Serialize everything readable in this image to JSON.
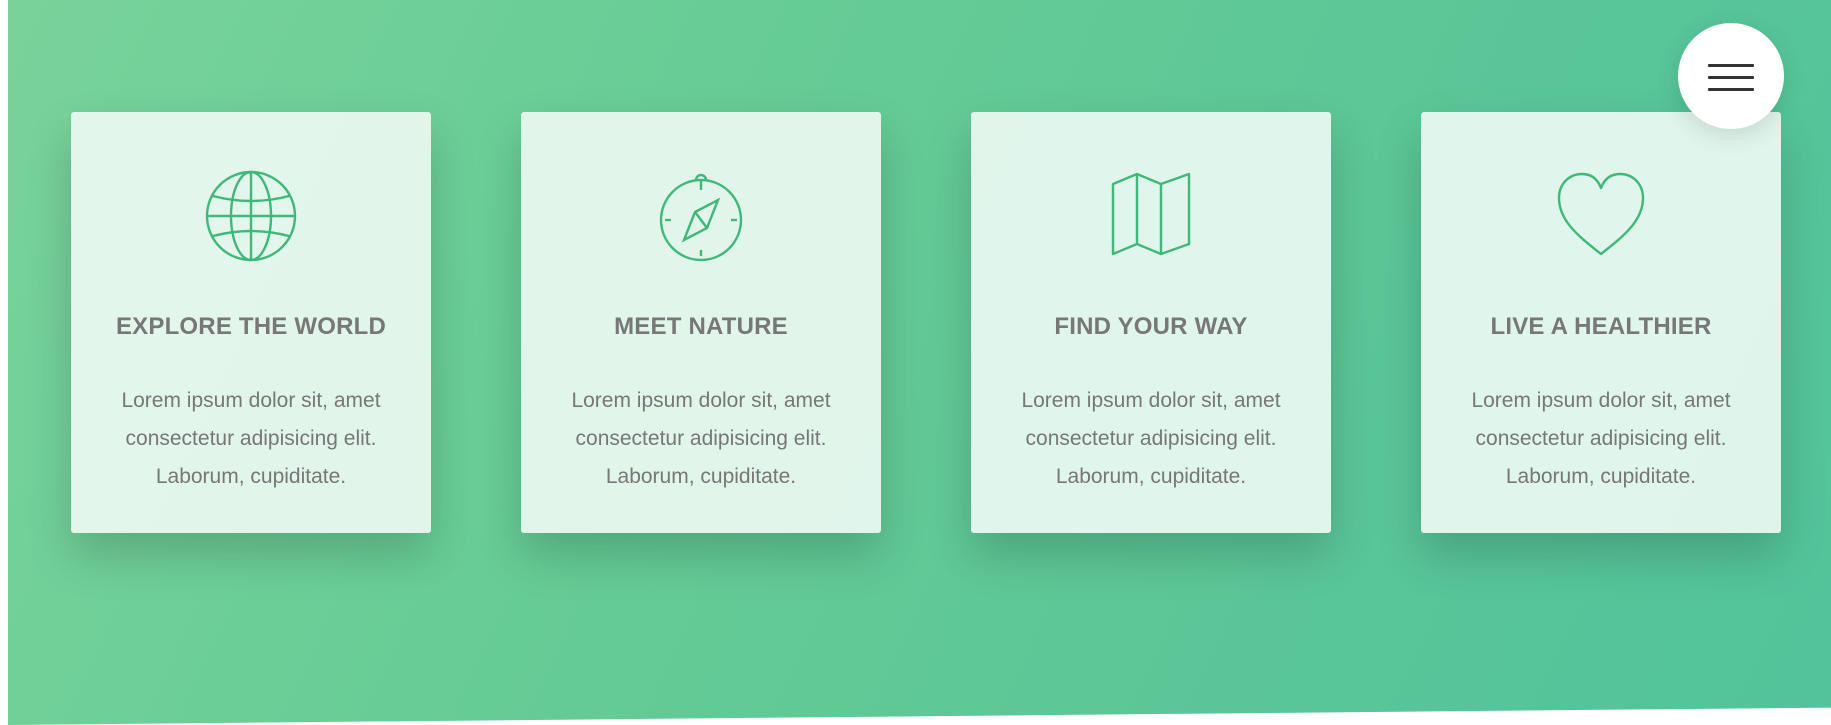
{
  "menu": {
    "icon": "hamburger-menu-icon"
  },
  "colors": {
    "accent": "#55c57a",
    "gradient_start": "#7ed56f",
    "gradient_end": "#28b485",
    "card_background": "#e6f7ee",
    "text": "#777777"
  },
  "features": [
    {
      "icon": "globe-icon",
      "title": "EXPLORE THE WORLD",
      "text": "Lorem ipsum dolor sit, amet consectetur adipisicing elit. Laborum, cupiditate."
    },
    {
      "icon": "compass-icon",
      "title": "MEET NATURE",
      "text": "Lorem ipsum dolor sit, amet consectetur adipisicing elit. Laborum, cupiditate."
    },
    {
      "icon": "map-icon",
      "title": "FIND YOUR WAY",
      "text": "Lorem ipsum dolor sit, amet consectetur adipisicing elit. Laborum, cupiditate."
    },
    {
      "icon": "heart-icon",
      "title": "LIVE A HEALTHIER",
      "text": "Lorem ipsum dolor sit, amet consectetur adipisicing elit. Laborum, cupiditate."
    }
  ]
}
